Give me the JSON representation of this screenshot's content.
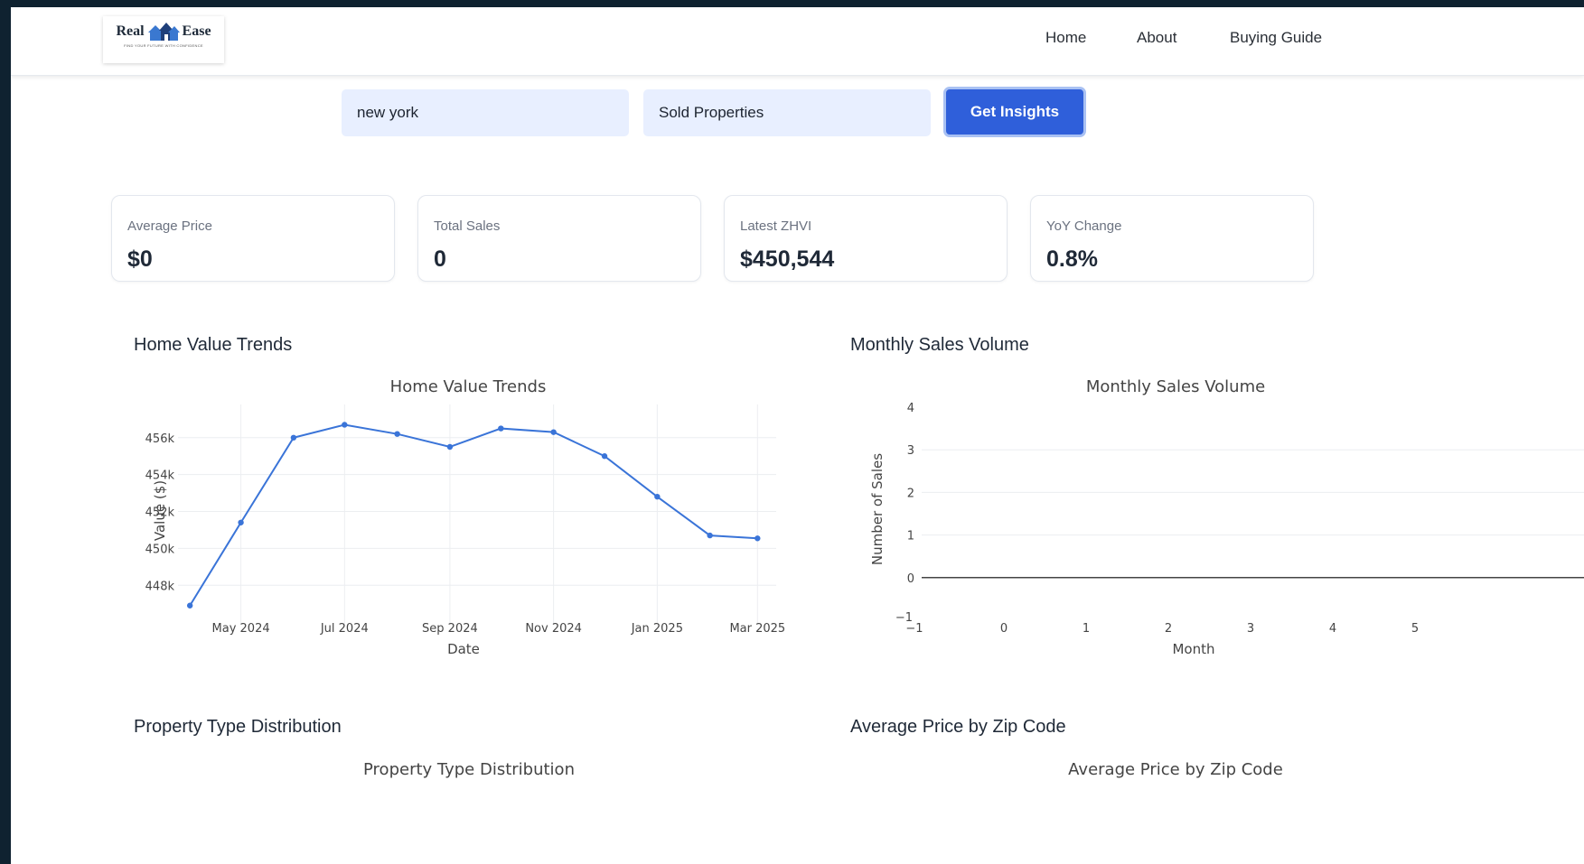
{
  "brand": {
    "logo_left": "Real",
    "logo_right": "Ease",
    "tagline": "FIND YOUR FUTURE WITH CONFIDENCE"
  },
  "nav": {
    "items": [
      "Home",
      "About",
      "Buying Guide"
    ]
  },
  "search": {
    "location_value": "new york",
    "type_value": "Sold Properties",
    "submit_label": "Get Insights"
  },
  "stats": [
    {
      "label": "Average Price",
      "value": "$0"
    },
    {
      "label": "Total Sales",
      "value": "0"
    },
    {
      "label": "Latest ZHVI",
      "value": "$450,544"
    },
    {
      "label": "YoY Change",
      "value": "0.8%"
    }
  ],
  "sections": {
    "home_value": "Home Value Trends",
    "monthly_sales": "Monthly Sales Volume",
    "property_type": "Property Type Distribution",
    "avg_price_zip": "Average Price by Zip Code"
  },
  "colors": {
    "accent": "#2f5fda",
    "line": "#3a74d8",
    "field_bg": "#e8efff"
  },
  "chart_data": [
    {
      "type": "line",
      "title": "Home Value Trends",
      "xlabel": "Date",
      "ylabel": "Value ($)",
      "x": [
        "2024-04-01",
        "2024-05-01",
        "2024-06-01",
        "2024-07-01",
        "2024-08-01",
        "2024-09-01",
        "2024-10-01",
        "2024-11-01",
        "2024-12-01",
        "2025-01-01",
        "2025-02-01",
        "2025-03-01"
      ],
      "y": [
        446900,
        451400,
        456000,
        456700,
        456200,
        455500,
        456500,
        456300,
        455000,
        452800,
        450700,
        450544
      ],
      "xticks": [
        "May 2024",
        "Jul 2024",
        "Sep 2024",
        "Nov 2024",
        "Jan 2025",
        "Mar 2025"
      ],
      "yticks": [
        "448k",
        "450k",
        "452k",
        "454k",
        "456k"
      ],
      "grid": true,
      "color": "#3a74d8"
    },
    {
      "type": "line",
      "title": "Monthly Sales Volume",
      "xlabel": "Month",
      "ylabel": "Number of Sales",
      "xlim": [
        -1,
        5
      ],
      "ylim": [
        -1,
        4
      ],
      "xticks": [
        "−1",
        "0",
        "1",
        "2",
        "3",
        "4",
        "5"
      ],
      "yticks": [
        "−1",
        "0",
        "1",
        "2",
        "3",
        "4"
      ],
      "grid": true,
      "series": []
    },
    {
      "type": "pie",
      "title": "Property Type Distribution"
    },
    {
      "type": "bar",
      "title": "Average Price by Zip Code"
    }
  ]
}
